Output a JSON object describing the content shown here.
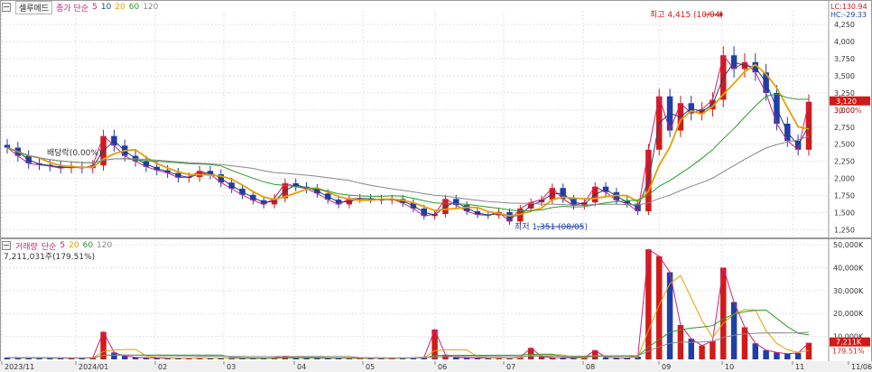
{
  "price_legend": {
    "name": "셀루메드",
    "ma_label": "종가 단순",
    "periods": [
      "5",
      "10",
      "20",
      "60",
      "120"
    ],
    "period_colors": [
      "#d1207a",
      "#1b3f8f",
      "#e5a000",
      "#2c9a2c",
      "#888888"
    ]
  },
  "volume_legend": {
    "name": "거래량",
    "ma_label": "단순",
    "periods": [
      "5",
      "20",
      "60",
      "120"
    ],
    "period_colors": [
      "#d1207a",
      "#e5a000",
      "#2c9a2c",
      "#888888"
    ],
    "current_volume": "7,211,031주(179.51%)"
  },
  "right_indicators": {
    "lc": "LC:130.94",
    "hc": "HC:-29.33",
    "current_price": "3,120",
    "current_change": "30.00%",
    "current_volume": "7,211K",
    "current_volume_pct": "179.51%"
  },
  "colors": {
    "up": "#d11a1a",
    "down": "#1f3fa8",
    "price_tag": "#d11a1a"
  },
  "chart_data": [
    {
      "type": "candlestick",
      "title": "",
      "ylim": [
        1150,
        4450
      ],
      "y_ticks": [
        "1,250",
        "1,500",
        "1,750",
        "2,000",
        "2,250",
        "2,500",
        "2,750",
        "3,000",
        "3,250",
        "3,500",
        "3,750",
        "4,000",
        "4,250"
      ],
      "x_ticks": [
        "2023/11",
        "2024/01",
        "02",
        "03",
        "04",
        "05",
        "06",
        "07",
        "08",
        "09",
        "10",
        "11",
        "11/06"
      ],
      "x_months": [
        "2023-11",
        "2023-12",
        "2024-01",
        "2024-02",
        "2024-03",
        "2024-04",
        "2024-05",
        "2024-06",
        "2024-07",
        "2024-08",
        "2024-09",
        "2024-10",
        "2024-11"
      ],
      "weekly_close": [
        2450,
        2330,
        2220,
        2200,
        2180,
        2150,
        2170,
        2150,
        2190,
        2620,
        2480,
        2330,
        2250,
        2170,
        2120,
        2080,
        2010,
        2020,
        2110,
        2060,
        1940,
        1850,
        1760,
        1680,
        1620,
        1710,
        1930,
        1880,
        1850,
        1780,
        1690,
        1620,
        1700,
        1710,
        1700,
        1680,
        1700,
        1640,
        1560,
        1450,
        1480,
        1700,
        1610,
        1520,
        1470,
        1460,
        1510,
        1370,
        1560,
        1650,
        1690,
        1860,
        1700,
        1600,
        1650,
        1880,
        1800,
        1680,
        1630,
        1520,
        2420,
        3200,
        2700,
        3100,
        2950,
        3010,
        3150,
        3800,
        3600,
        3700,
        3550,
        3250,
        2800,
        2550,
        2420,
        3120
      ],
      "annotations": {
        "high": "최고 4,415 (10/04)",
        "low": "최저 1,351 (08/05)",
        "dividend": "배당락(0.00%)"
      },
      "moving_averages": [
        "5",
        "10",
        "20",
        "60",
        "120"
      ]
    },
    {
      "type": "bar",
      "title": "",
      "ylim": [
        0,
        52000
      ],
      "y_ticks": [
        "10,000K",
        "20,000K",
        "30,000K",
        "40,000K",
        "50,000K"
      ],
      "weekly_volume_k": [
        800,
        700,
        600,
        600,
        600,
        500,
        600,
        500,
        700,
        12000,
        3000,
        1500,
        900,
        700,
        600,
        500,
        600,
        500,
        700,
        600,
        600,
        500,
        500,
        400,
        500,
        700,
        1400,
        800,
        700,
        600,
        500,
        500,
        600,
        500,
        500,
        500,
        500,
        600,
        700,
        900,
        13000,
        2000,
        900,
        700,
        600,
        600,
        700,
        500,
        900,
        5000,
        1200,
        800,
        700,
        600,
        700,
        4000,
        900,
        700,
        600,
        1200,
        48000,
        45000,
        38000,
        15000,
        9000,
        6000,
        8000,
        40000,
        25000,
        14000,
        7000,
        4000,
        3000,
        2500,
        2800,
        7211
      ]
    }
  ]
}
